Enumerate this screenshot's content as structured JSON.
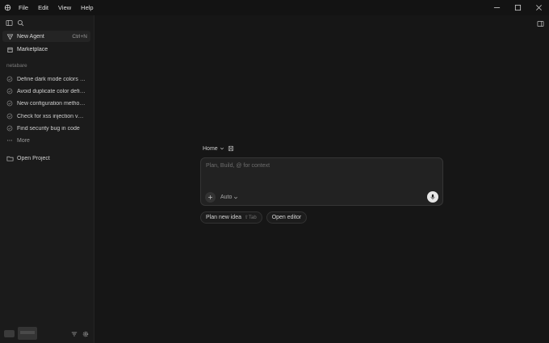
{
  "menu": [
    "File",
    "Edit",
    "View",
    "Help"
  ],
  "sidebar": {
    "new_agent": {
      "label": "New Agent",
      "shortcut": "Ctrl+N"
    },
    "marketplace": "Marketplace",
    "section": "netabare",
    "threads": [
      "Define dark mode colors in …",
      "Avoid duplicate color defini…",
      "New configuration methods…",
      "Check for xss injection vuln…",
      "Find security bug in code"
    ],
    "more": "More",
    "open_project": "Open Project"
  },
  "main": {
    "breadcrumb": "Home",
    "composer": {
      "placeholder": "Plan, Build, @ for context",
      "mode": "Auto"
    },
    "chips": {
      "plan": "Plan new idea",
      "plan_hint": "⇧Tab",
      "open_editor": "Open editor"
    }
  }
}
